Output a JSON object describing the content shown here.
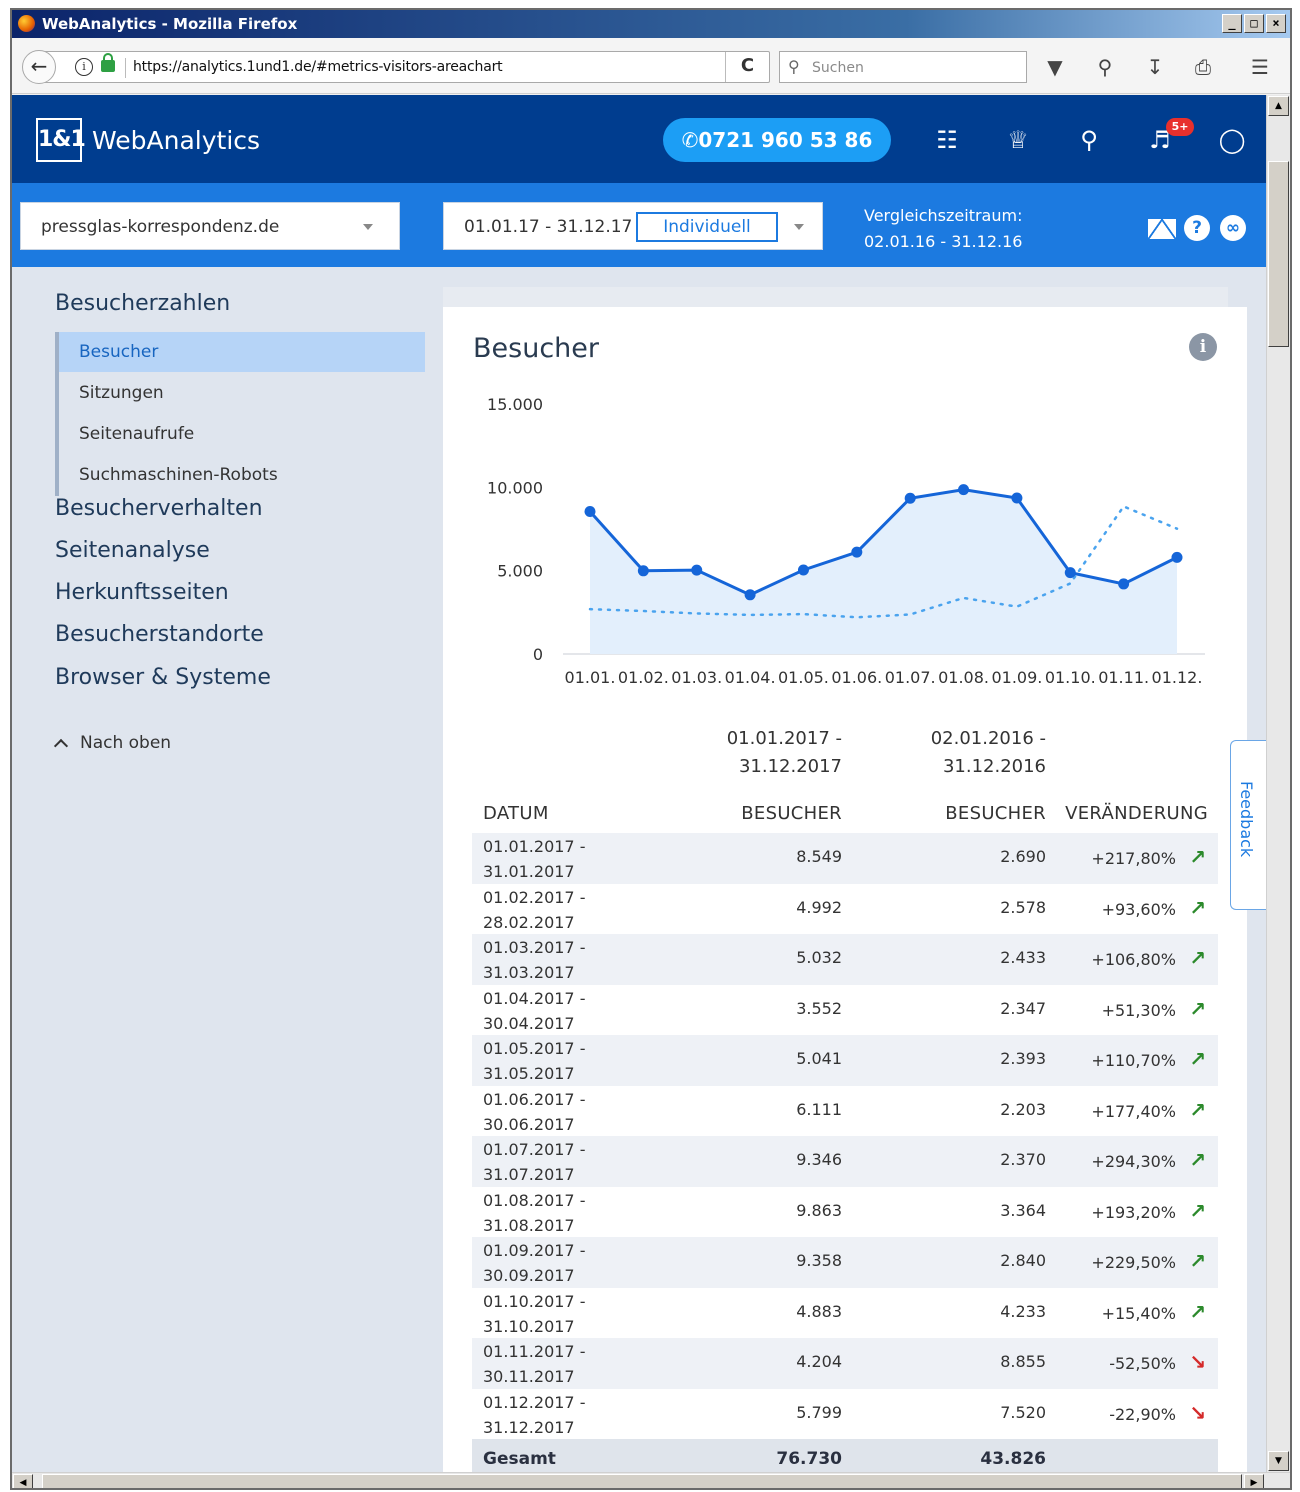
{
  "window": {
    "title": "WebAnalytics - Mozilla Firefox",
    "buttons": [
      "_",
      "□",
      "×"
    ]
  },
  "browser": {
    "url": "https://analytics.1und1.de/#metrics-visitors-areachart",
    "search_placeholder": "Suchen",
    "back_glyph": "←",
    "reload_glyph": "C",
    "toolbar_icons": [
      "pocket-icon",
      "magnifier-icon",
      "download-icon",
      "print-icon",
      "menu-icon"
    ]
  },
  "header": {
    "logo_box": "1&1",
    "logo_name": "WebAnalytics",
    "phone": "0721 960 53 86",
    "notification_badge": "5+"
  },
  "filters": {
    "domain": "pressglas-korrespondenz.de",
    "date_range": "01.01.17 - 31.12.17",
    "date_mode": "Individuell",
    "compare_label": "Vergleichszeitraum:",
    "compare_range": "02.01.16 - 31.12.16"
  },
  "sidebar": {
    "sections": [
      "Besucherzahlen",
      "Besucherverhalten",
      "Seitenanalyse",
      "Herkunftsseiten",
      "Besucherstandorte",
      "Browser & Systeme"
    ],
    "sub_items": [
      "Besucher",
      "Sitzungen",
      "Seitenaufrufe",
      "Suchmaschinen-Robots"
    ],
    "active_sub": "Besucher",
    "to_top": "Nach oben"
  },
  "card": {
    "title": "Besucher"
  },
  "chart_data": {
    "type": "area",
    "categories": [
      "01.01.",
      "01.02.",
      "01.03.",
      "01.04.",
      "01.05.",
      "01.06.",
      "01.07.",
      "01.08.",
      "01.09.",
      "01.10.",
      "01.11.",
      "01.12."
    ],
    "yticks": [
      "15.000",
      "10.000",
      "5.000",
      "0"
    ],
    "ylim": [
      0,
      15000
    ],
    "series": [
      {
        "values": [
          8549,
          4992,
          5032,
          3552,
          5041,
          6111,
          9346,
          9863,
          9358,
          4883,
          4204,
          5799
        ],
        "color": "#1565d8",
        "style": "solid-area"
      },
      {
        "values": [
          2690,
          2578,
          2433,
          2347,
          2393,
          2203,
          2370,
          3364,
          2840,
          4233,
          8855,
          7520
        ],
        "color": "#4aa3ee",
        "style": "dotted"
      }
    ],
    "grid": false,
    "legend": "none"
  },
  "table": {
    "period_current": [
      "01.01.2017 -",
      "31.12.2017"
    ],
    "period_compare": [
      "02.01.2016 -",
      "31.12.2016"
    ],
    "headers": [
      "DATUM",
      "BESUCHER",
      "BESUCHER",
      "VERÄNDERUNG"
    ],
    "rows": [
      {
        "from": "01.01.2017 -",
        "to": "31.01.2017",
        "cur": "8.549",
        "prev": "2.690",
        "chg": "+217,80%",
        "dir": "up"
      },
      {
        "from": "01.02.2017 -",
        "to": "28.02.2017",
        "cur": "4.992",
        "prev": "2.578",
        "chg": "+93,60%",
        "dir": "up"
      },
      {
        "from": "01.03.2017 -",
        "to": "31.03.2017",
        "cur": "5.032",
        "prev": "2.433",
        "chg": "+106,80%",
        "dir": "up"
      },
      {
        "from": "01.04.2017 -",
        "to": "30.04.2017",
        "cur": "3.552",
        "prev": "2.347",
        "chg": "+51,30%",
        "dir": "up"
      },
      {
        "from": "01.05.2017 -",
        "to": "31.05.2017",
        "cur": "5.041",
        "prev": "2.393",
        "chg": "+110,70%",
        "dir": "up"
      },
      {
        "from": "01.06.2017 -",
        "to": "30.06.2017",
        "cur": "6.111",
        "prev": "2.203",
        "chg": "+177,40%",
        "dir": "up"
      },
      {
        "from": "01.07.2017 -",
        "to": "31.07.2017",
        "cur": "9.346",
        "prev": "2.370",
        "chg": "+294,30%",
        "dir": "up"
      },
      {
        "from": "01.08.2017 -",
        "to": "31.08.2017",
        "cur": "9.863",
        "prev": "3.364",
        "chg": "+193,20%",
        "dir": "up"
      },
      {
        "from": "01.09.2017 -",
        "to": "30.09.2017",
        "cur": "9.358",
        "prev": "2.840",
        "chg": "+229,50%",
        "dir": "up"
      },
      {
        "from": "01.10.2017 -",
        "to": "31.10.2017",
        "cur": "4.883",
        "prev": "4.233",
        "chg": "+15,40%",
        "dir": "up"
      },
      {
        "from": "01.11.2017 -",
        "to": "30.11.2017",
        "cur": "4.204",
        "prev": "8.855",
        "chg": "-52,50%",
        "dir": "down"
      },
      {
        "from": "01.12.2017 -",
        "to": "31.12.2017",
        "cur": "5.799",
        "prev": "7.520",
        "chg": "-22,90%",
        "dir": "down"
      }
    ],
    "total_label": "Gesamt",
    "total_cur": "76.730",
    "total_prev": "43.826"
  },
  "feedback": "Feedback"
}
